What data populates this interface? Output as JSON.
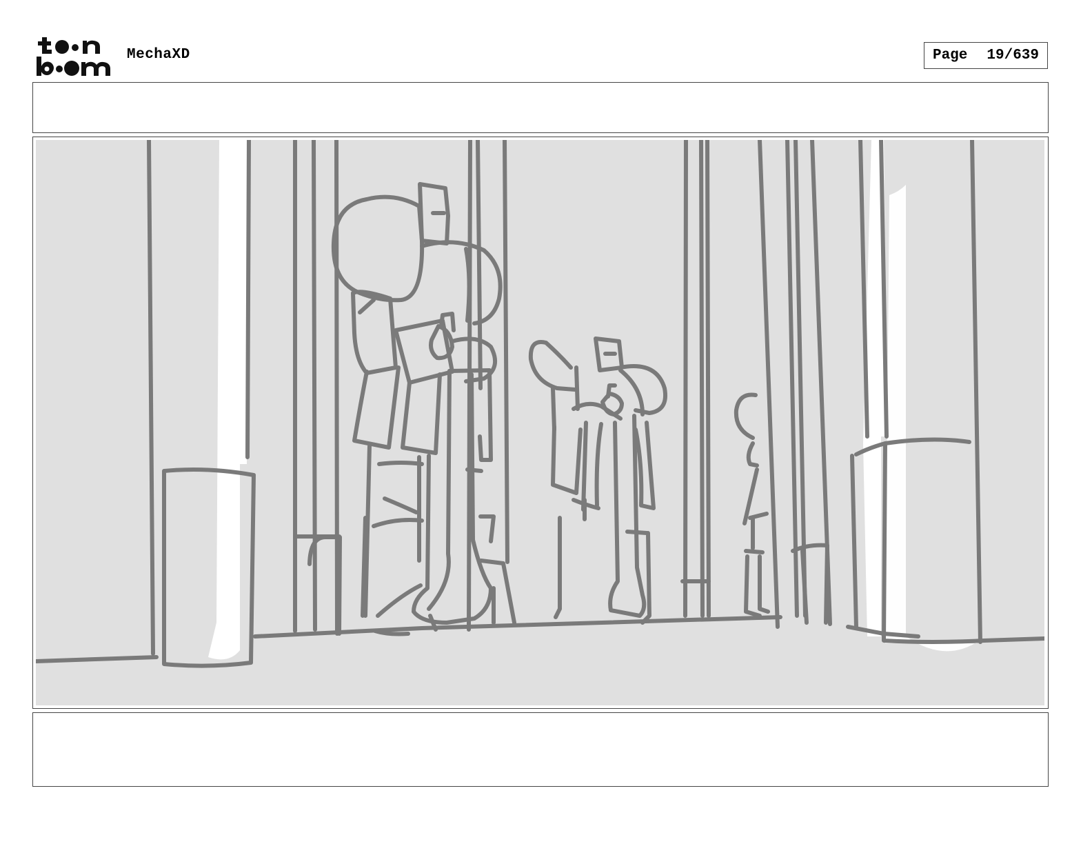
{
  "header": {
    "logo_text": "toon boom",
    "project_title": "MechaXD",
    "page_label": "Page",
    "page_value": "19/639"
  },
  "colors": {
    "panel_background": "#e0e0e0",
    "sketch_stroke": "#7a7a7a",
    "highlight": "#ffffff",
    "frame_border": "#444444"
  },
  "panel": {
    "description_icon": "storyboard-sketch"
  }
}
